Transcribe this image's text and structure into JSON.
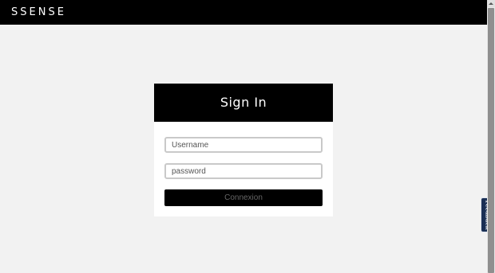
{
  "header": {
    "logo_text": "SSENSE"
  },
  "signin": {
    "title": "Sign In",
    "username_placeholder": "Username",
    "password_placeholder": "password",
    "submit_label": "Connexion"
  },
  "feedback_tab": {
    "label": "Feedback"
  },
  "colors": {
    "page_background": "#f2f2f2",
    "header_background": "#000000",
    "card_background": "#ffffff",
    "button_background": "#000000",
    "feedback_background": "#1a2f55"
  },
  "icons": {
    "scroll_up": "scroll-up-arrow-icon"
  }
}
